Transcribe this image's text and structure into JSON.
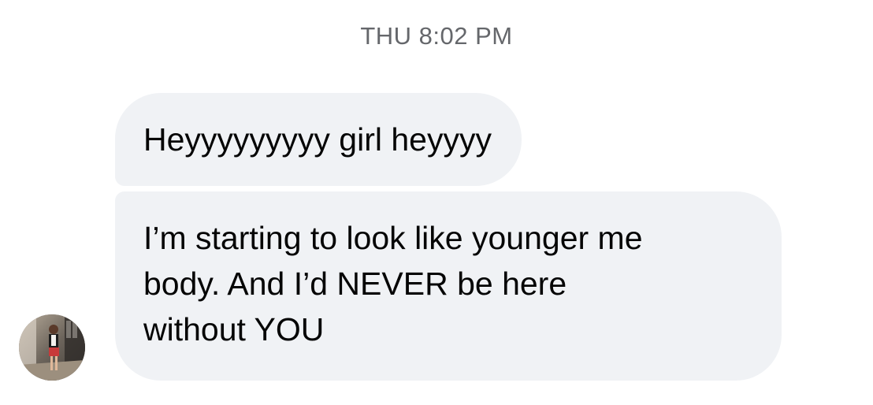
{
  "conversation": {
    "timestamp": "THU 8:02 PM",
    "messages": [
      {
        "lines": [
          "Heyyyyyyyyy girl heyyyy"
        ]
      },
      {
        "lines": [
          "I’m starting to look like younger me",
          "body. And I’d NEVER be here",
          "without YOU"
        ]
      }
    ],
    "sender_avatar": "avatar-photo"
  },
  "colors": {
    "bubble_background": "#f0f2f5",
    "message_text": "#050505",
    "timestamp_text": "#65676b",
    "background": "#ffffff"
  }
}
